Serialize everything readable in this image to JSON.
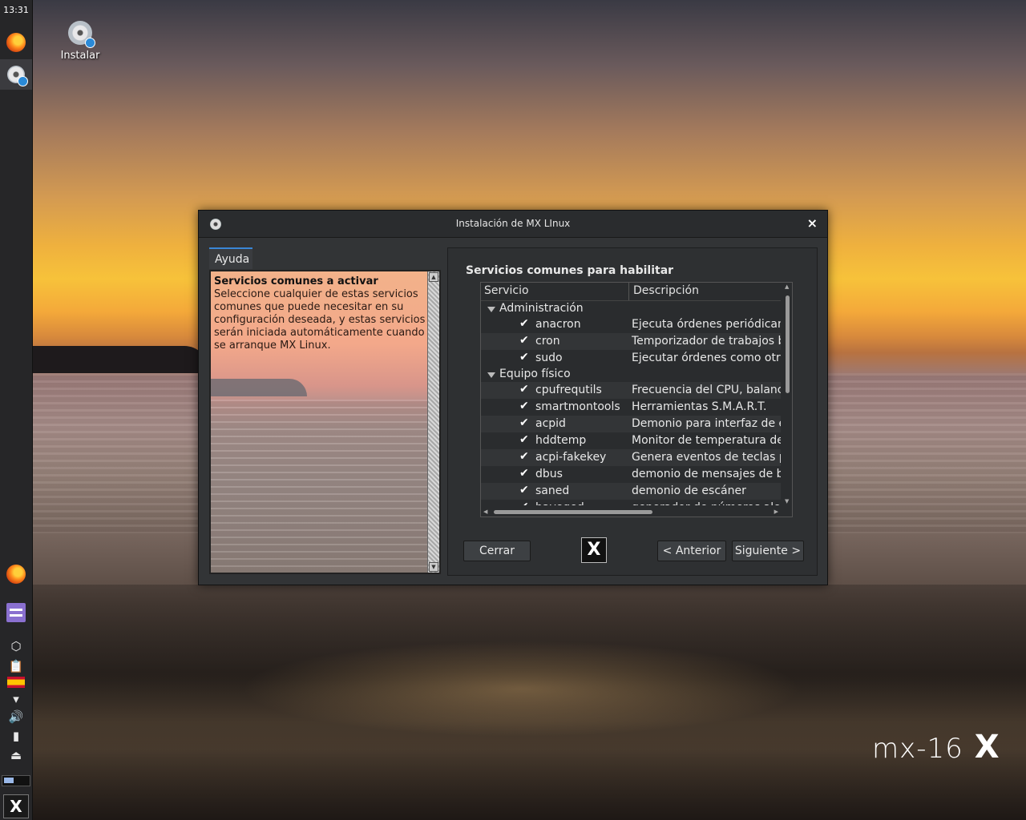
{
  "panel": {
    "clock": "13:31"
  },
  "desktop": {
    "install_icon_label": "Instalar",
    "watermark": "mx-16"
  },
  "dialog": {
    "title": "Instalación de MX LInux",
    "close_glyph": "×",
    "help_tab": "Ayuda",
    "help_heading": "Servicios comunes a activar",
    "help_body": "Seleccione cualquier de estas servicios comunes que puede necesitar en su configuración deseada, y estas servicios serán iniciada automáticamente cuando se arranque MX Linux.",
    "section_title": "Servicios comunes para habilitar",
    "columns": {
      "service": "Servicio",
      "description": "Descripción"
    },
    "groups": [
      {
        "name": "Administración",
        "items": [
          {
            "name": "anacron",
            "desc": "Ejecuta órdenes periódicame",
            "checked": true
          },
          {
            "name": "cron",
            "desc": "Temporizador de trabajos bas",
            "checked": true
          },
          {
            "name": "sudo",
            "desc": "Ejecutar órdenes como otro u",
            "checked": true
          }
        ]
      },
      {
        "name": "Equipo físico",
        "items": [
          {
            "name": "cpufrequtils",
            "desc": "Frecuencia del CPU, balance i",
            "checked": true
          },
          {
            "name": "smartmontools",
            "desc": "Herramientas S.M.A.R.T.",
            "checked": true
          },
          {
            "name": "acpid",
            "desc": "Demonio para interfaz de ene",
            "checked": true
          },
          {
            "name": "hddtemp",
            "desc": "Monitor de temperatura del d",
            "checked": true
          },
          {
            "name": "acpi-fakekey",
            "desc": "Genera eventos de teclas par",
            "checked": true
          },
          {
            "name": "dbus",
            "desc": "demonio de mensajes de bus",
            "checked": true
          },
          {
            "name": "saned",
            "desc": "demonio de escáner",
            "checked": true
          },
          {
            "name": "haveged",
            "desc": "generador de números aleato",
            "checked": true
          }
        ]
      }
    ],
    "buttons": {
      "close": "Cerrar",
      "back": "< Anterior",
      "next": "Siguiente >"
    }
  }
}
